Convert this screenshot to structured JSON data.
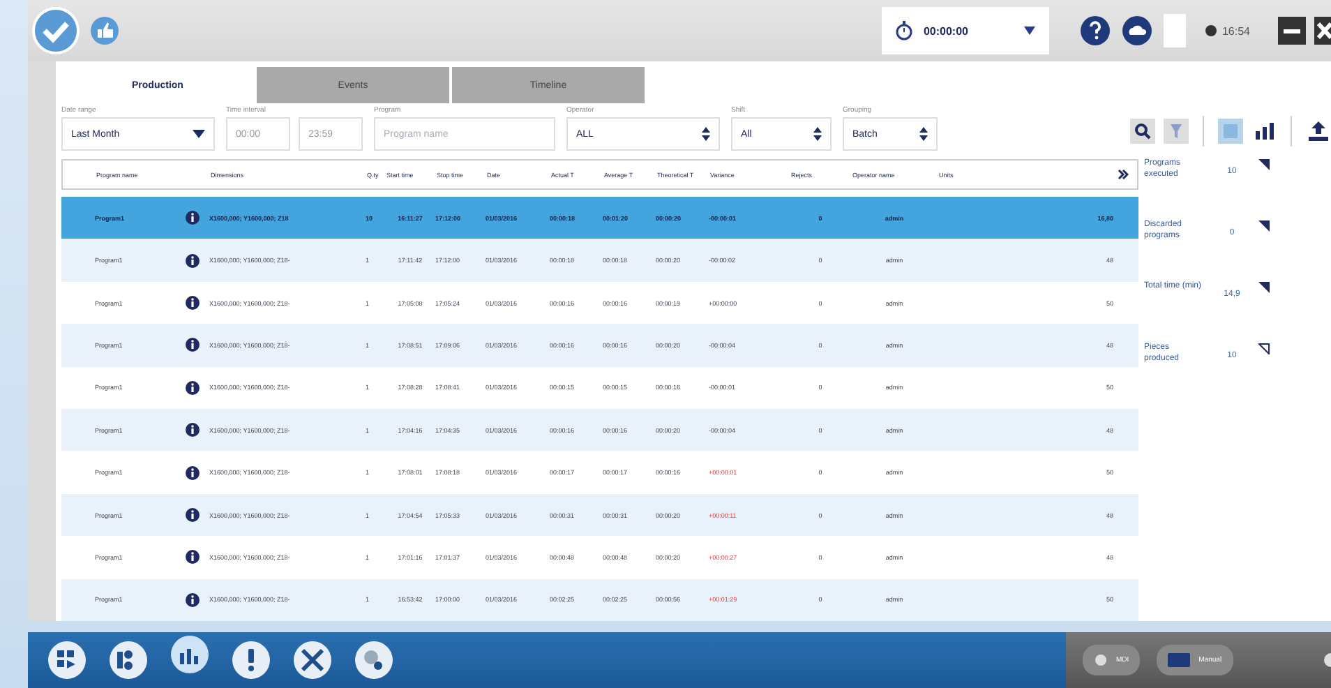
{
  "top_bar": {
    "timer": "00:00:00",
    "clock": "16:54"
  },
  "tabs": [
    {
      "label": "Production",
      "selected": true
    },
    {
      "label": "Events",
      "selected": false
    },
    {
      "label": "Timeline",
      "selected": false
    }
  ],
  "filters": [
    {
      "kind": "select",
      "label": "Date range",
      "value": "Last Month"
    },
    {
      "kind": "time",
      "label": "Time interval",
      "values": [
        "00:00",
        "23:59"
      ]
    },
    {
      "kind": "text",
      "label": "Program",
      "placeholder": "Program name"
    },
    {
      "kind": "spin",
      "label": "Operator",
      "value": "ALL"
    },
    {
      "kind": "spin",
      "label": "Shift",
      "value": "All"
    },
    {
      "kind": "spin",
      "label": "Grouping",
      "value": "Batch"
    }
  ],
  "table": {
    "columns": [
      "Program name",
      "Dimensions",
      "Q.ty",
      "Start time",
      "Stop time",
      "Date",
      "Actual T",
      "Average T",
      "Theoretical T",
      "Variance",
      "Rejects",
      "Operator name",
      "Units"
    ],
    "rows": [
      {
        "selected": true,
        "late": false,
        "cells": [
          "Program1",
          "X1600,000; Y1600,000; Z18",
          "10",
          "16:11:27",
          "17:12:00",
          "01/03/2016",
          "00:00:18",
          "00:01:20",
          "00:00:20",
          "-00:00:01",
          "0",
          "admin",
          "16,80"
        ]
      },
      {
        "selected": false,
        "late": false,
        "cells": [
          "Program1",
          "X1600,000; Y1600,000; Z18-",
          "1",
          "17:11:42",
          "17:12:00",
          "01/03/2016",
          "00:00:18",
          "00:00:18",
          "00:00:20",
          "-00:00:02",
          "0",
          "admin",
          "48"
        ]
      },
      {
        "selected": false,
        "late": false,
        "cells": [
          "Program1",
          "X1600,000; Y1600,000; Z18-",
          "1",
          "17:05:08",
          "17:05:24",
          "01/03/2016",
          "00:00:16",
          "00:00:16",
          "00:00:19",
          "+00:00:00",
          "0",
          "admin",
          "50"
        ]
      },
      {
        "selected": false,
        "late": false,
        "cells": [
          "Program1",
          "X1600,000; Y1600,000; Z18-",
          "1",
          "17:08:51",
          "17:09:06",
          "01/03/2016",
          "00:00:16",
          "00:00:16",
          "00:00:20",
          "-00:00:04",
          "0",
          "admin",
          "48"
        ]
      },
      {
        "selected": false,
        "late": false,
        "cells": [
          "Program1",
          "X1600,000; Y1600,000; Z18-",
          "1",
          "17:08:28",
          "17:08:41",
          "01/03/2016",
          "00:00:15",
          "00:00:15",
          "00:00:16",
          "-00:00:01",
          "0",
          "admin",
          "50"
        ]
      },
      {
        "selected": false,
        "late": false,
        "cells": [
          "Program1",
          "X1600,000; Y1600,000; Z18-",
          "1",
          "17:04:16",
          "17:04:35",
          "01/03/2016",
          "00:00:16",
          "00:00:16",
          "00:00:20",
          "-00:00:04",
          "0",
          "admin",
          "48"
        ]
      },
      {
        "selected": false,
        "late": true,
        "cells": [
          "Program1",
          "X1600,000; Y1600,000; Z18-",
          "1",
          "17:08:01",
          "17:08:18",
          "01/03/2016",
          "00:00:17",
          "00:00:17",
          "00:00:16",
          "+00:00:01",
          "0",
          "admin",
          "50"
        ]
      },
      {
        "selected": false,
        "late": true,
        "cells": [
          "Program1",
          "X1600,000; Y1600,000; Z18-",
          "1",
          "17:04:54",
          "17:05:33",
          "01/03/2016",
          "00:00:31",
          "00:00:31",
          "00:00:20",
          "+00:00:11",
          "0",
          "admin",
          "48"
        ]
      },
      {
        "selected": false,
        "late": true,
        "cells": [
          "Program1",
          "X1600,000; Y1600,000; Z18-",
          "1",
          "17:01:16",
          "17:01:37",
          "01/03/2016",
          "00:00:48",
          "00:00:48",
          "00:00:20",
          "+00:00:27",
          "0",
          "admin",
          "48"
        ]
      },
      {
        "selected": false,
        "late": true,
        "cells": [
          "Program1",
          "X1600,000; Y1600,000; Z18-",
          "1",
          "16:53:42",
          "17:00:00",
          "01/03/2016",
          "00:02:25",
          "00:02:25",
          "00:00:56",
          "+00:01:29",
          "0",
          "admin",
          "50"
        ]
      }
    ]
  },
  "stats": [
    {
      "label": "Programs executed",
      "value": "10",
      "filled": true
    },
    {
      "label": "Discarded programs",
      "value": "0",
      "filled": true
    },
    {
      "label": "Total time (min)",
      "value": "14,9",
      "filled": true
    },
    {
      "label": "Pieces produced",
      "value": "10",
      "filled": false
    }
  ],
  "taskbar": {
    "apps": [
      {
        "selected": false
      },
      {
        "selected": false
      },
      {
        "selected": true
      },
      {
        "selected": false
      },
      {
        "selected": false
      },
      {
        "selected": false
      }
    ],
    "modes": [
      "MDI",
      "Manual"
    ]
  }
}
